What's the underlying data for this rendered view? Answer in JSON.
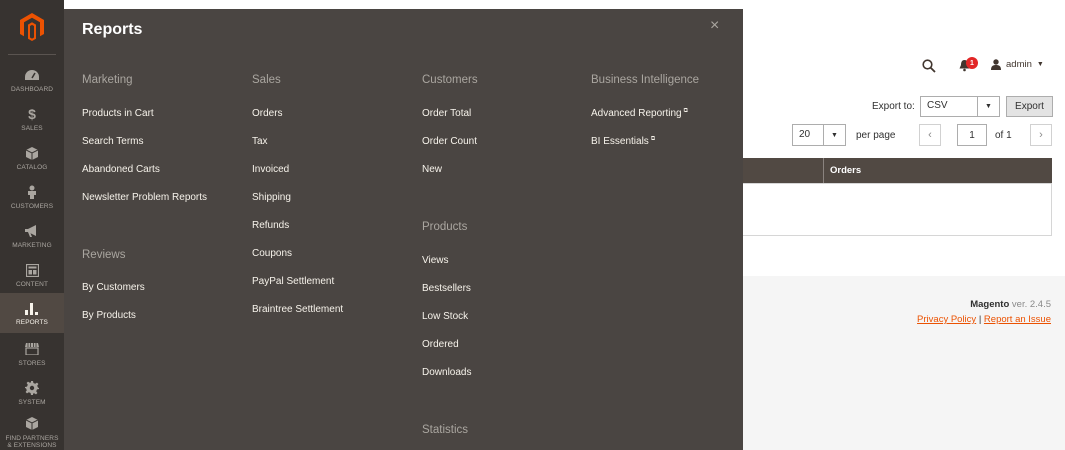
{
  "nav": {
    "items": [
      {
        "label": "Dashboard",
        "icon": "dashboard-icon"
      },
      {
        "label": "Sales",
        "icon": "dollar-icon"
      },
      {
        "label": "Catalog",
        "icon": "cube-icon"
      },
      {
        "label": "Customers",
        "icon": "person-icon"
      },
      {
        "label": "Marketing",
        "icon": "megaphone-icon"
      },
      {
        "label": "Content",
        "icon": "layout-icon"
      },
      {
        "label": "Reports",
        "icon": "bar-chart-icon"
      },
      {
        "label": "Stores",
        "icon": "store-icon"
      },
      {
        "label": "System",
        "icon": "gear-icon"
      },
      {
        "label": "Find Partners & Extensions",
        "icon": "cube-icon"
      }
    ],
    "active": "Reports"
  },
  "flyout": {
    "title": "Reports",
    "close": "×",
    "sections": {
      "marketing": {
        "title": "Marketing",
        "links": [
          "Products in Cart",
          "Search Terms",
          "Abandoned Carts",
          "Newsletter Problem Reports"
        ]
      },
      "reviews": {
        "title": "Reviews",
        "links": [
          "By Customers",
          "By Products"
        ]
      },
      "sales": {
        "title": "Sales",
        "links": [
          "Orders",
          "Tax",
          "Invoiced",
          "Shipping",
          "Refunds",
          "Coupons",
          "PayPal Settlement",
          "Braintree Settlement"
        ]
      },
      "customers": {
        "title": "Customers",
        "links": [
          "Order Total",
          "Order Count",
          "New"
        ]
      },
      "products": {
        "title": "Products",
        "links": [
          "Views",
          "Bestsellers",
          "Low Stock",
          "Ordered",
          "Downloads"
        ]
      },
      "statistics": {
        "title": "Statistics"
      },
      "bi": {
        "title": "Business Intelligence",
        "links": [
          "Advanced Reporting",
          "BI Essentials"
        ]
      }
    }
  },
  "header": {
    "user": "admin",
    "notifications_count": "1"
  },
  "toolbar": {
    "export_label": "Export to:",
    "export_format": "CSV",
    "export_button": "Export",
    "per_page_value": "20",
    "per_page_label": "per page",
    "page_value": "1",
    "page_of": "of 1"
  },
  "grid": {
    "columns": [
      "Orders"
    ]
  },
  "footer": {
    "brand": "Magento",
    "version": "ver. 2.4.5",
    "privacy": "Privacy Policy",
    "separator": "|",
    "report_issue": "Report an Issue"
  },
  "colors": {
    "nav_bg": "#373330",
    "flyout_bg": "#4a4542",
    "accent": "#eb5202",
    "badge": "#e22626",
    "grid_header": "#514943"
  }
}
